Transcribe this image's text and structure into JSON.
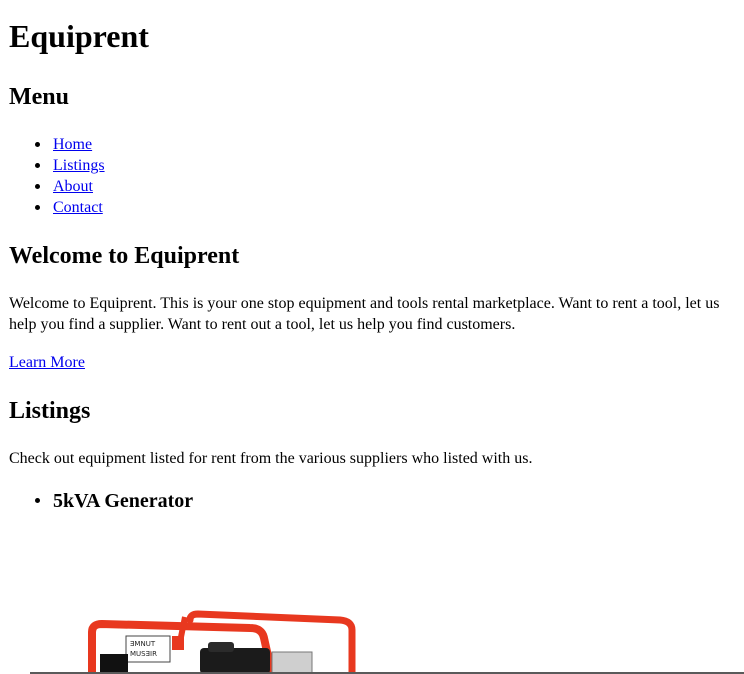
{
  "site": {
    "title": "Equiprent"
  },
  "menu": {
    "title": "Menu",
    "items": [
      {
        "label": "Home"
      },
      {
        "label": "Listings"
      },
      {
        "label": "About"
      },
      {
        "label": "Contact"
      }
    ]
  },
  "welcome": {
    "title": "Welcome to Equiprent",
    "text": "Welcome to Equiprent. This is your one stop equipment and tools rental marketplace. Want to rent a tool, let us help you find a supplier. Want to rent out a tool, let us help you find customers.",
    "learn_more_label": "Learn More"
  },
  "listings": {
    "title": "Listings",
    "text": "Check out equipment listed for rent from the various suppliers who listed with us.",
    "items": [
      {
        "name": "5kVA Generator",
        "image": "generator-image"
      }
    ]
  },
  "colors": {
    "link": "#0000ee",
    "generator_frame": "#e8381f"
  }
}
